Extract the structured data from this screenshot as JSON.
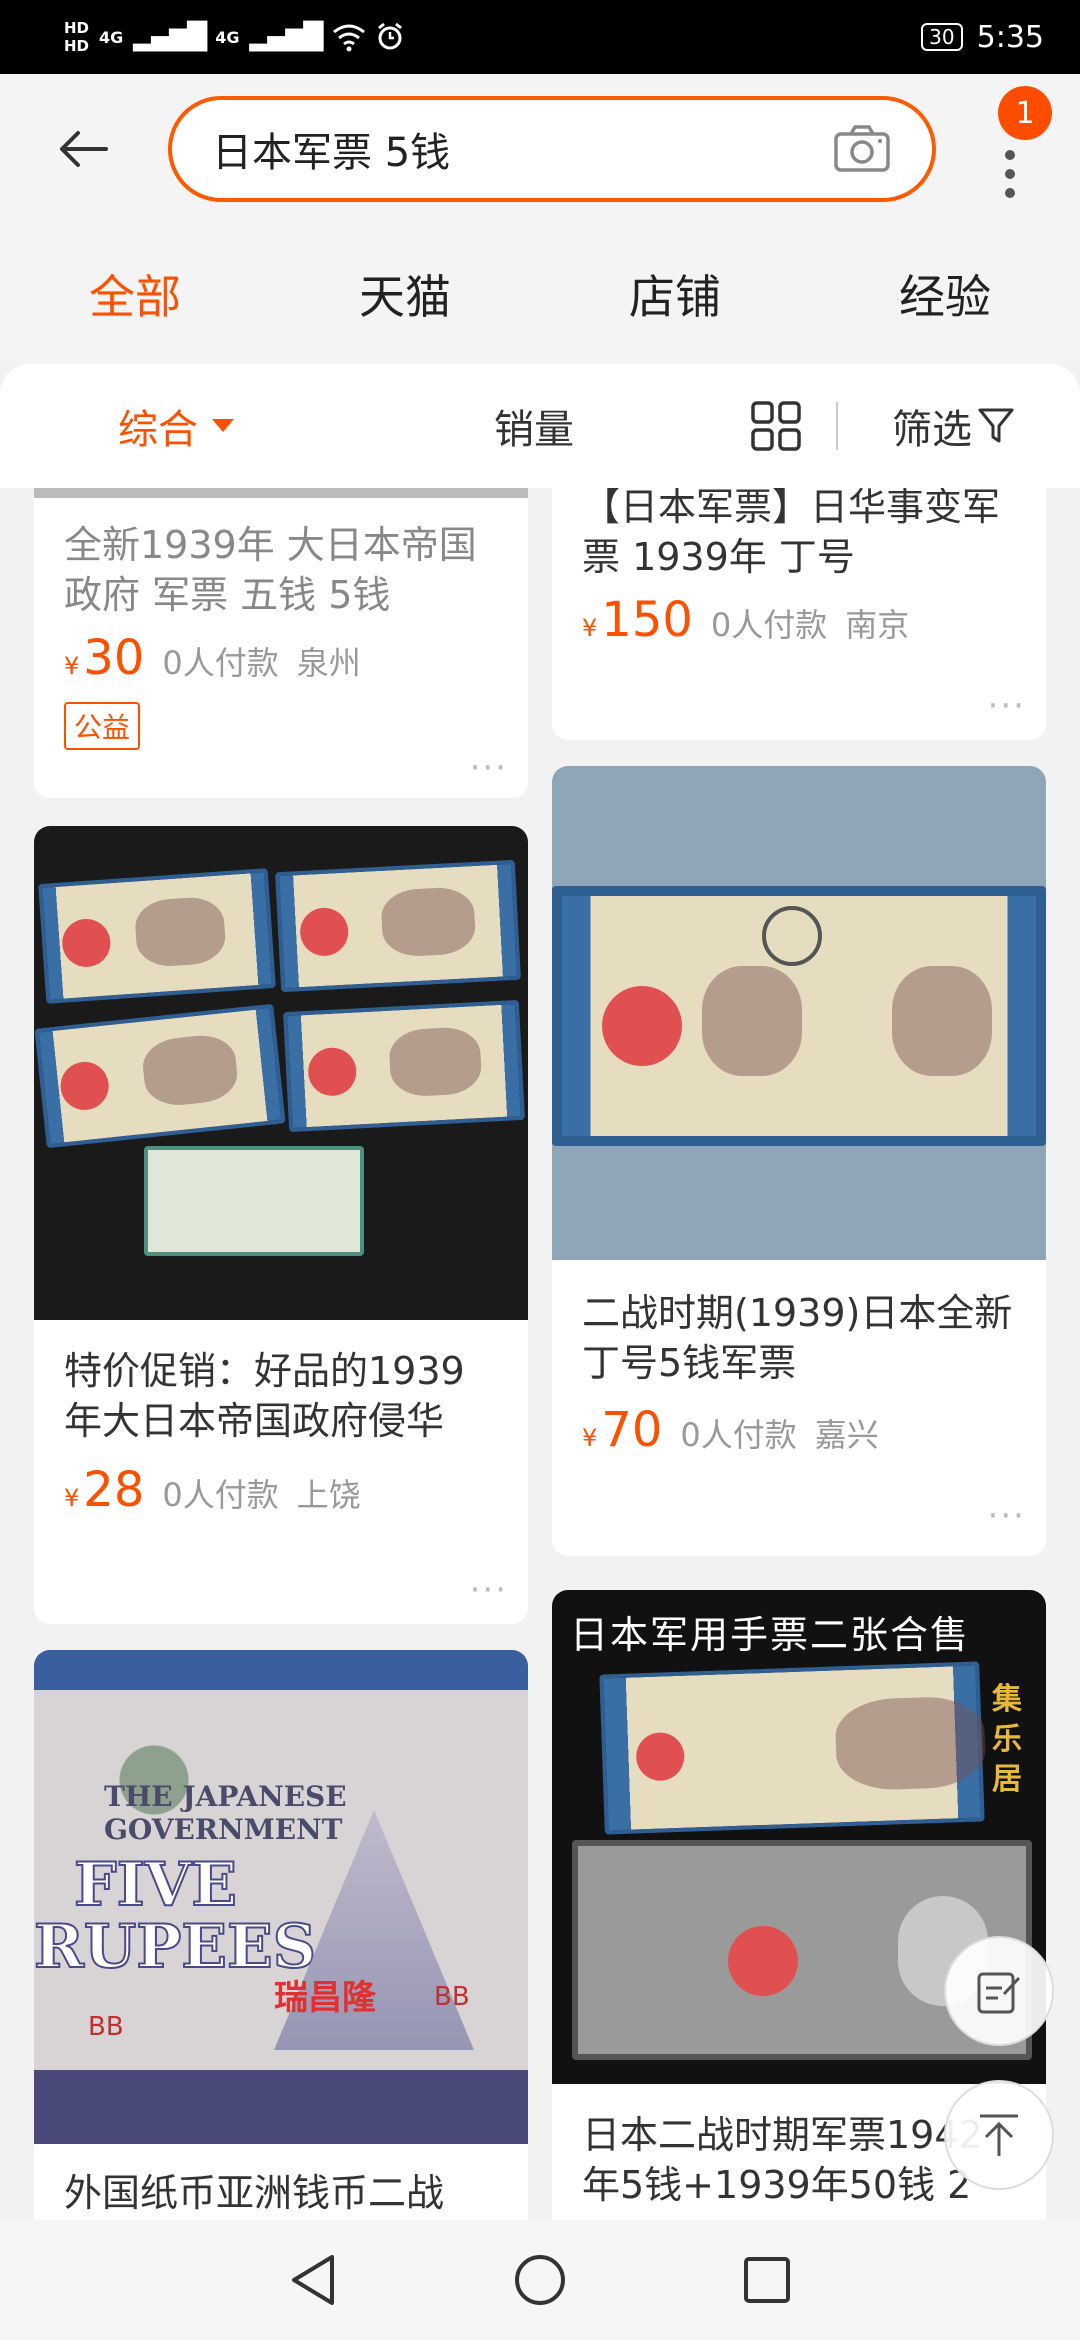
{
  "status_bar": {
    "hd1": "HD",
    "hd2": "HD",
    "network1": "4G",
    "network2": "4G",
    "battery": "30",
    "time": "5:35"
  },
  "header": {
    "search_query": "日本军票 5钱",
    "cart_badge": "1"
  },
  "category_tabs": [
    {
      "label": "全部",
      "active": true
    },
    {
      "label": "天猫",
      "active": false
    },
    {
      "label": "店铺",
      "active": false
    },
    {
      "label": "经验",
      "active": false
    }
  ],
  "filter_bar": {
    "sort_label": "综合",
    "sales_label": "销量",
    "filter_label": "筛选"
  },
  "products": [
    {
      "title": "全新1939年 大日本帝国政府 军票 五钱 5钱",
      "yen": "¥",
      "price": "30",
      "sold": "0人付款",
      "city": "泉州",
      "tag": "公益"
    },
    {
      "title": "【日本军票】日华事变军票 1939年 丁号",
      "yen": "¥",
      "price": "150",
      "sold": "0人付款",
      "city": "南京"
    },
    {
      "title": "特价促销：好品的1939年大日本帝国政府侵华",
      "yen": "¥",
      "price": "28",
      "sold": "0人付款",
      "city": "上饶"
    },
    {
      "title": "二战时期(1939)日本全新丁号5钱军票",
      "yen": "¥",
      "price": "70",
      "sold": "0人付款",
      "city": "嘉兴"
    },
    {
      "title": "外国纸币亚洲钱币二战",
      "image_text": {
        "line1": "THE JAPANESE GOVERNMENT",
        "line2": "FIVE",
        "line3": "RUPEES",
        "stamp": "瑞昌隆",
        "code": "BB"
      }
    },
    {
      "title": "日本二战时期军票1942年5钱+1939年50钱 2",
      "image_text": {
        "banner": "日本军用手票二张合售",
        "side": "集乐居"
      }
    }
  ],
  "colors": {
    "accent": "#ff5000",
    "background": "#f2f2f2",
    "card": "#ffffff"
  }
}
